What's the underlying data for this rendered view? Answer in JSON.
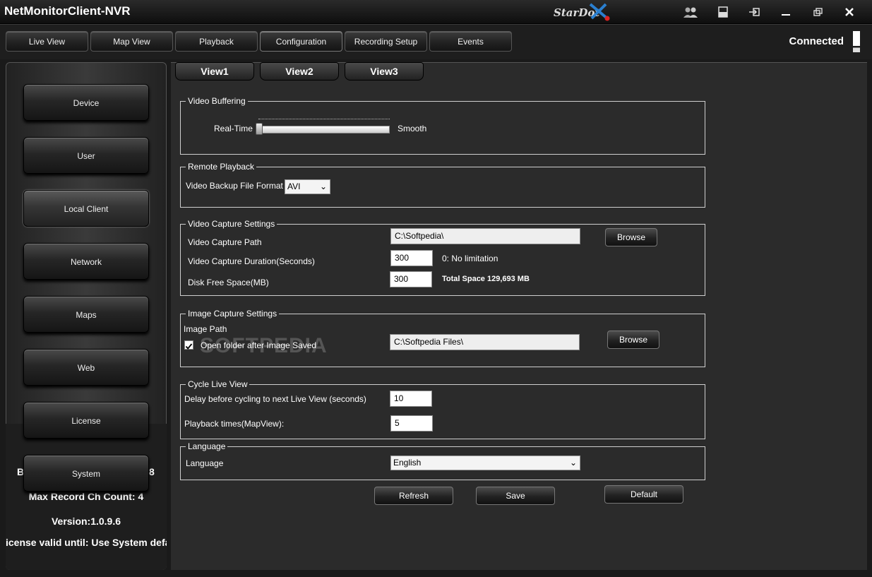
{
  "app": {
    "title": "NetMonitorClient-NVR",
    "logo": "StarDot",
    "status": "Connected"
  },
  "titlebar_icons": [
    "users-icon",
    "layout-icon",
    "login-icon",
    "minimize-icon",
    "restore-icon",
    "close-icon"
  ],
  "nav_tabs": [
    "Live View",
    "Map View",
    "Playback",
    "Configuration",
    "Recording Setup",
    "Events"
  ],
  "view_tabs": [
    "View1",
    "View2",
    "View3"
  ],
  "sidebar": {
    "buttons": [
      "Device",
      "User",
      "Local Client",
      "Network",
      "Maps",
      "Web",
      "License",
      "System"
    ],
    "active": "Local Client",
    "info_line1_left": "B",
    "info_line1_right": "8",
    "max_record": "Max Record Ch Count: 4",
    "version": "Version:1.0.9.6",
    "license": "icense valid until: Use System defau"
  },
  "video_buffering": {
    "title": "Video Buffering",
    "left_label": "Real-Time",
    "right_label": "Smooth",
    "slider_value": 0
  },
  "remote_playback": {
    "title": "Remote Playback",
    "format_label": "Video Backup File Format",
    "format_value": "AVI"
  },
  "video_capture": {
    "title": "Video Capture Settings",
    "path_label": "Video Capture Path",
    "path_value": "C:\\Softpedia\\",
    "browse": "Browse",
    "duration_label": "Video Capture Duration(Seconds)",
    "duration_value": "300",
    "duration_hint": "0: No limitation",
    "disk_label": "Disk Free Space(MB)",
    "disk_value": "300",
    "total_space": "Total Space 129,693 MB"
  },
  "image_capture": {
    "title": "Image Capture Settings",
    "path_label": "Image Path",
    "open_folder_label": "Open folder after Image Saved",
    "open_folder_checked": true,
    "path_value": "C:\\Softpedia Files\\",
    "browse": "Browse"
  },
  "cycle_live_view": {
    "title": "Cycle Live View",
    "delay_label": "Delay before cycling to next Live View (seconds)",
    "delay_value": "10",
    "playback_label": "Playback times(MapView):",
    "playback_value": "5"
  },
  "language": {
    "title": "Language",
    "label": "Language",
    "value": "English"
  },
  "actions": {
    "refresh": "Refresh",
    "save": "Save",
    "default": "Default"
  },
  "watermark": "SOFTPEDIA"
}
